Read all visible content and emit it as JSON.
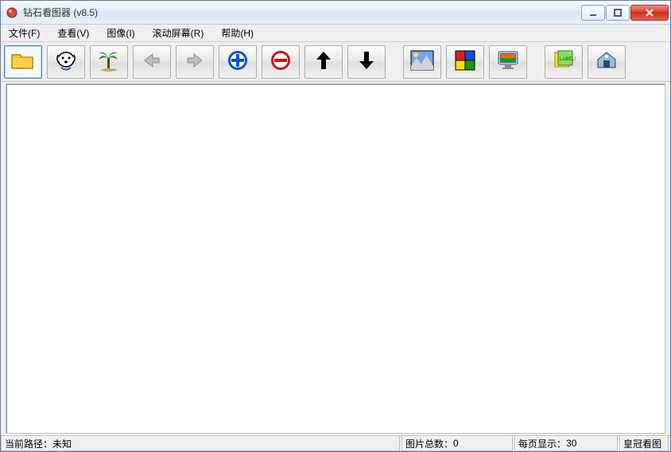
{
  "window": {
    "title": "钻石看图器 (v8.5)"
  },
  "menus": {
    "file": "文件(F)",
    "view": "查看(V)",
    "image": "图像(I)",
    "scroll": "滚动屏幕(R)",
    "help": "帮助(H)"
  },
  "status": {
    "path_label": "当前路径：",
    "path_value": "未知",
    "total_label": "图片总数：",
    "total_value": "0",
    "perpage_label": "每页显示：",
    "perpage_value": "30",
    "brand": "皇冠看图"
  }
}
